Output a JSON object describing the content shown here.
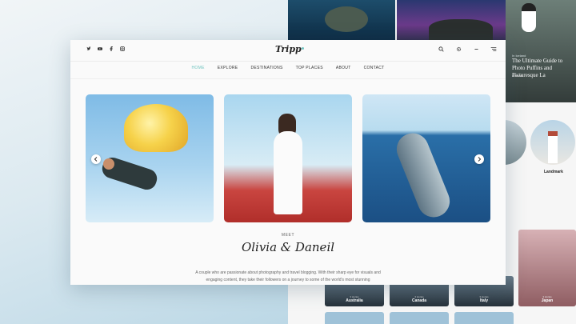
{
  "background_page": {
    "featured": {
      "category": "In Iceland",
      "title": "The Ultimate Guide to Photo Puffins and Picturesque La",
      "location": "Iceland"
    },
    "circle_label": "Landmark",
    "countries": [
      {
        "subtitle": "3 stories",
        "name": "Australia"
      },
      {
        "subtitle": "3 stories",
        "name": "Canada"
      },
      {
        "subtitle": "3 stories",
        "name": "Italy"
      },
      {
        "subtitle": "3 stories",
        "name": "Japan"
      }
    ]
  },
  "header": {
    "logo": "Tripp",
    "social_icons": [
      "twitter-icon",
      "youtube-icon",
      "facebook-icon",
      "instagram-icon"
    ],
    "tools": [
      "search-icon",
      "settings-icon",
      "minus-icon",
      "menu-icon"
    ]
  },
  "nav": {
    "items": [
      "HOME",
      "EXPLORE",
      "DESTINATIONS",
      "TOP PLACES",
      "ABOUT",
      "CONTACT"
    ],
    "active_index": 0,
    "accent_color": "#6fc3bf"
  },
  "carousel": {
    "slides": [
      "parachute-photo",
      "woman-in-poppy-field-photo",
      "whale-underwater-photo"
    ],
    "prev_icon": "chevron-left-icon",
    "next_icon": "chevron-right-icon"
  },
  "intro": {
    "kicker": "MEET",
    "names": "Olivia & Daneil",
    "description": "A couple who are passionate about photography and travel blogging. With their sharp eye for visuals and engaging content, they take their followers on a journey to some of the world's most stunning"
  }
}
